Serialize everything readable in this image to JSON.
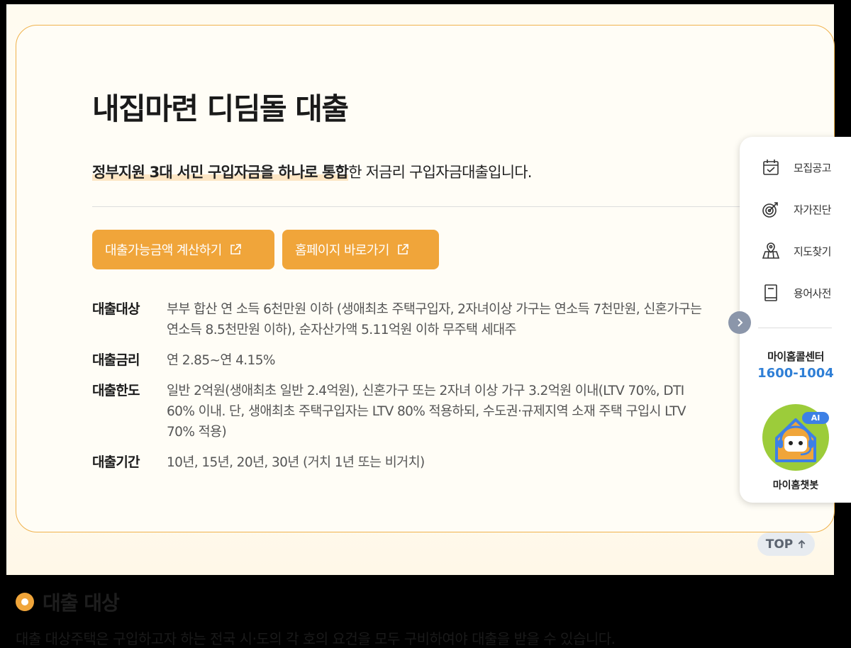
{
  "loan": {
    "title": "내집마련 디딤돌 대출",
    "subtitle_highlight": "정부지원 3대 서민 구입자금을 하나로 통합",
    "subtitle_rest": "한 저금리 구입자금대출입니다.",
    "buttons": {
      "calc": "대출가능금액 계산하기",
      "homepage": "홈페이지 바로가기"
    },
    "info": [
      {
        "label": "대출대상",
        "value": "부부 합산 연 소득 6천만원 이하 (생애최초 주택구입자, 2자녀이상 가구는 연소득 7천만원, 신혼가구는\n연소득 8.5천만원 이하), 순자산가액 5.11억원 이하 무주택 세대주"
      },
      {
        "label": "대출금리",
        "value": "연 2.85~연 4.15%"
      },
      {
        "label": "대출한도",
        "value": "일반 2억원(생애최초 일반 2.4억원), 신혼가구 또는 2자녀 이상 가구 3.2억원 이내(LTV 70%, DTI\n60% 이내. 단, 생애최초 주택구입자는 LTV 80% 적용하되, 수도권·규제지역 소재 주택 구입시 LTV\n70% 적용)"
      },
      {
        "label": "대출기간",
        "value": "10년, 15년, 20년, 30년 (거치 1년 또는 비거치)"
      }
    ]
  },
  "quick_menu": {
    "items": [
      {
        "label": "모집공고",
        "icon": "calendar-check-icon"
      },
      {
        "label": "자가진단",
        "icon": "target-icon"
      },
      {
        "label": "지도찾기",
        "icon": "map-pin-icon"
      },
      {
        "label": "용어사전",
        "icon": "book-icon"
      }
    ],
    "call_center_label": "마이홈콜센터",
    "call_center_number": "1600-1004",
    "ai_badge": "AI",
    "chatbot_label": "마이홈챗봇"
  },
  "top_button": {
    "label": "TOP"
  },
  "section": {
    "title": "대출 대상",
    "body": "대출 대상주택은 구입하고자 하는 전국 시·도의 각 호의 요건을 모두 구비하여야 대출을 받을 수 있습니다."
  },
  "colors": {
    "accent": "#f0a53a",
    "card_border": "#f0b24d",
    "call_number": "#2f7fd6",
    "ai_badge": "#3d80e6",
    "chatbot_bg": "#9ccc3a"
  }
}
